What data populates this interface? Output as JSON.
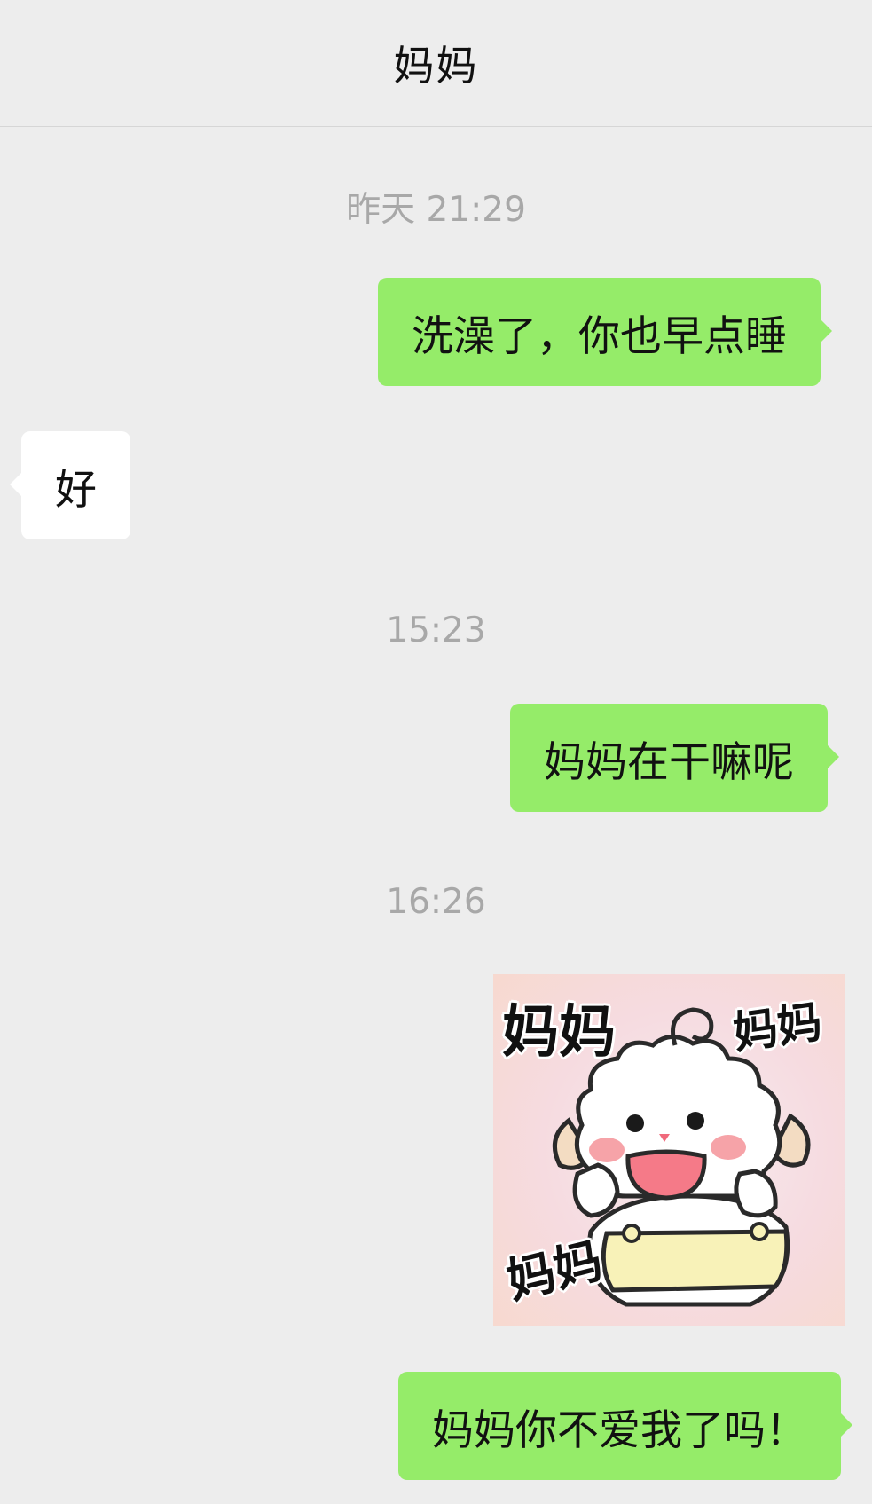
{
  "header": {
    "title": "妈妈"
  },
  "messages": [
    {
      "type": "timestamp",
      "text": "昨天 21:29"
    },
    {
      "type": "text",
      "side": "me",
      "text": "洗澡了，你也早点睡"
    },
    {
      "type": "text",
      "side": "them",
      "text": "好"
    },
    {
      "type": "timestamp",
      "text": "15:23"
    },
    {
      "type": "text",
      "side": "me",
      "text": "妈妈在干嘛呢"
    },
    {
      "type": "timestamp",
      "text": "16:26"
    },
    {
      "type": "sticker",
      "side": "me",
      "captions": [
        "妈妈",
        "妈妈",
        "妈妈"
      ]
    },
    {
      "type": "text",
      "side": "me",
      "text": "妈妈你不爱我了吗！"
    }
  ],
  "colors": {
    "background": "#ededed",
    "my_bubble": "#95ec69",
    "their_bubble": "#ffffff",
    "timestamp": "#a8a8a8"
  }
}
